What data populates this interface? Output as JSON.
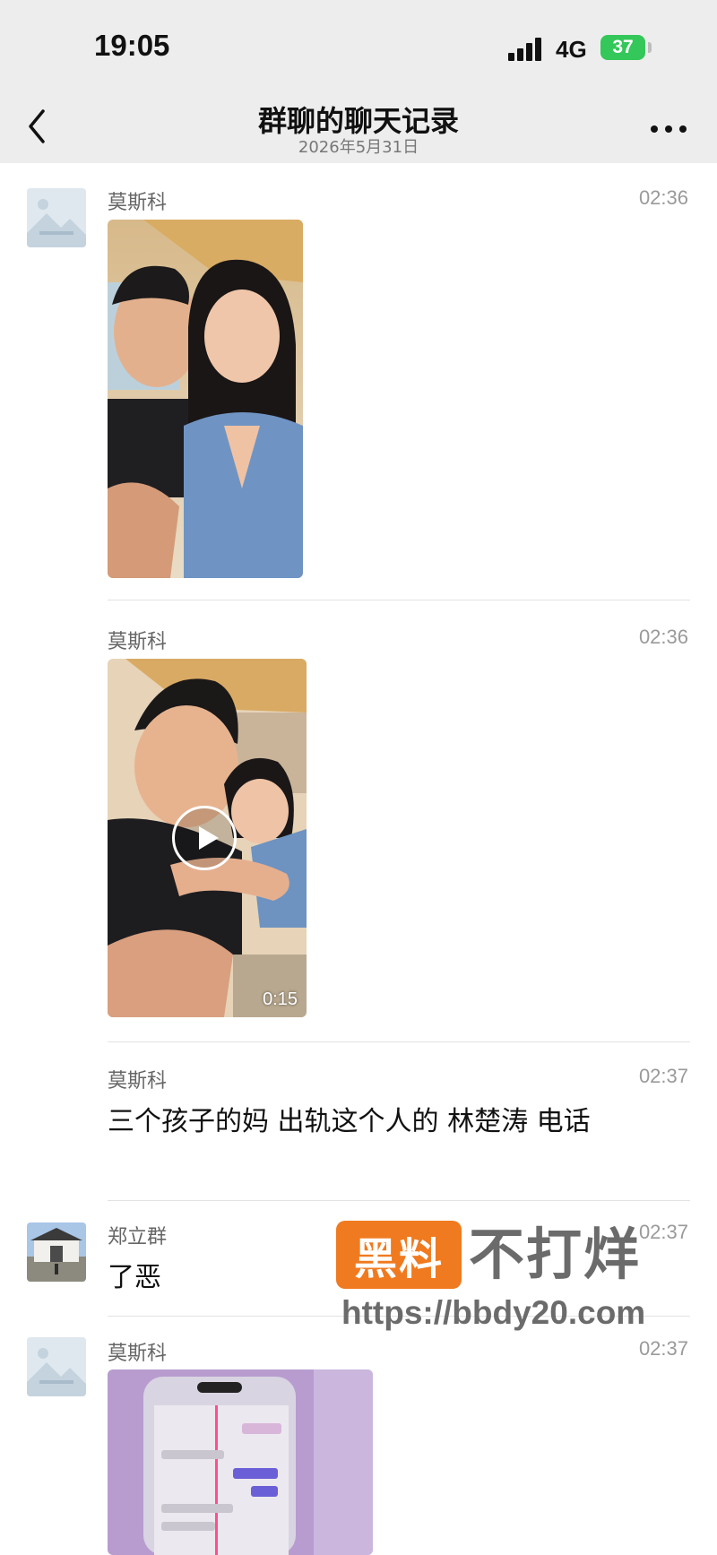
{
  "status_bar": {
    "time": "19:05",
    "network": "4G",
    "battery": "37"
  },
  "header": {
    "title": "群聊的聊天记录",
    "date": "2026年5月31日"
  },
  "messages": [
    {
      "sender": "莫斯科",
      "time": "02:36",
      "kind": "image"
    },
    {
      "sender": "莫斯科",
      "time": "02:36",
      "kind": "video",
      "duration": "0:15"
    },
    {
      "sender": "莫斯科",
      "time": "02:37",
      "kind": "text",
      "text": "三个孩子的妈 出轨这个人的 林楚涛 电话"
    },
    {
      "sender": "郑立群",
      "time": "02:37",
      "kind": "text",
      "text": "了恶"
    },
    {
      "sender": "莫斯科",
      "time": "02:37",
      "kind": "image"
    }
  ],
  "watermark": {
    "badge": "黑料",
    "text": "不打烊",
    "url": "https://bbdy20.com"
  },
  "colors": {
    "header_bg": "#ededed",
    "battery_green": "#34c759",
    "watermark_orange": "#f07a1f"
  }
}
